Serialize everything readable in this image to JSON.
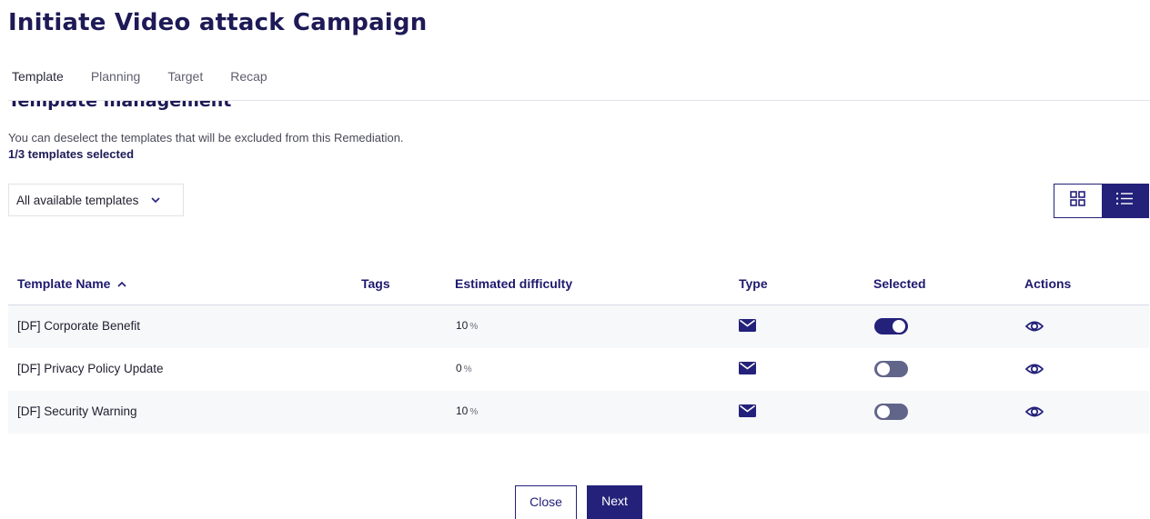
{
  "page": {
    "title": "Initiate Video attack Campaign"
  },
  "tabs": [
    {
      "label": "Template",
      "active": true
    },
    {
      "label": "Planning",
      "active": false
    },
    {
      "label": "Target",
      "active": false
    },
    {
      "label": "Recap",
      "active": false
    }
  ],
  "section": {
    "title": "Template management",
    "description": "You can deselect the templates that will be excluded from this Remediation.",
    "count": "1/3 templates selected"
  },
  "filter": {
    "selected": "All available templates",
    "icon": "chevron-down-icon"
  },
  "view_toggle": {
    "options": [
      "grid-view-icon",
      "list-view-icon"
    ],
    "active": "list-view-icon"
  },
  "table": {
    "columns": [
      "Template Name",
      "Tags",
      "Estimated difficulty",
      "Type",
      "Selected",
      "Actions"
    ],
    "sort": {
      "column": "Template Name",
      "direction": "ascending"
    },
    "rows": [
      {
        "name": "[DF] Corporate Benefit",
        "tags": "",
        "difficulty": "10",
        "difficulty_unit": "%",
        "type": "email-icon",
        "selected": true,
        "action": "eye-icon"
      },
      {
        "name": "[DF] Privacy Policy Update",
        "tags": "",
        "difficulty": "0",
        "difficulty_unit": "%",
        "type": "email-icon",
        "selected": false,
        "action": "eye-icon"
      },
      {
        "name": "[DF] Security Warning",
        "tags": "",
        "difficulty": "10",
        "difficulty_unit": "%",
        "type": "email-icon",
        "selected": false,
        "action": "eye-icon"
      }
    ]
  },
  "footer": {
    "secondary_label": "Close",
    "primary_label": "Next"
  },
  "colors": {
    "primary": "#24217a",
    "heading": "#1d1a56",
    "toggle_off": "#62658a",
    "row_shade": "#f7f8fa"
  }
}
